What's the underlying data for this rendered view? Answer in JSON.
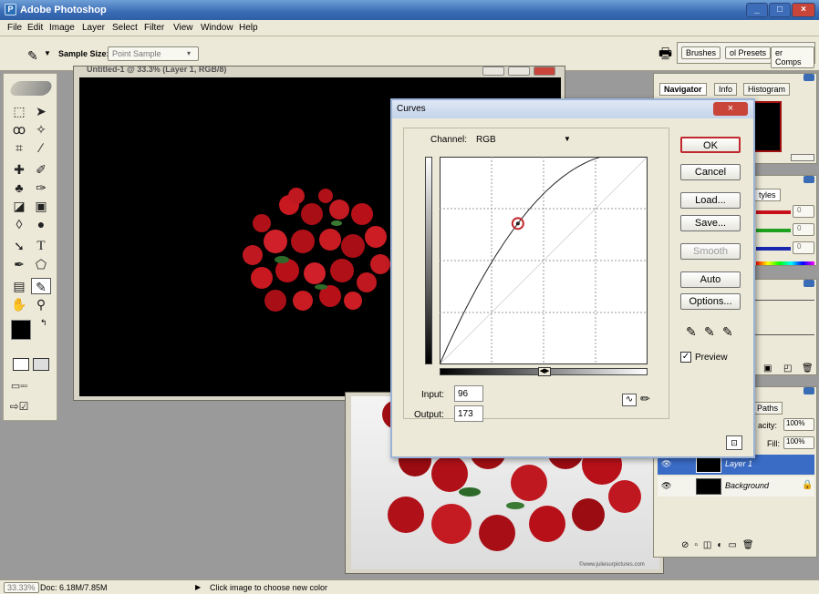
{
  "app": {
    "title": "Adobe Photoshop"
  },
  "menu": [
    "File",
    "Edit",
    "Image",
    "Layer",
    "Select",
    "Filter",
    "View",
    "Window",
    "Help"
  ],
  "options": {
    "sample_size_label": "Sample Size:",
    "sample_size_value": "Point Sample"
  },
  "palette_well": {
    "tabs": [
      "Brushes",
      "ol Presets",
      "er Comps"
    ]
  },
  "doc_title": "Untitled-1 @ 33.3% (Layer 1, RGB/8)",
  "navigator": {
    "tabs": [
      "Navigator",
      "Info",
      "Histogram"
    ]
  },
  "color_panel": {
    "tab": "tyles",
    "values": [
      "0",
      "0",
      "0"
    ]
  },
  "layers": {
    "tab": "Paths",
    "opacity_label": "acity:",
    "opacity_value": "100%",
    "fill_label": "Fill:",
    "fill_value": "100%",
    "rows": [
      {
        "name": "Layer 1"
      },
      {
        "name": "Background"
      }
    ]
  },
  "watermark": "©www.juliesurpictures.com",
  "curves": {
    "title": "Curves",
    "channel_label": "Channel:",
    "channel_value": "RGB",
    "input_label": "Input:",
    "input_value": "96",
    "output_label": "Output:",
    "output_value": "173",
    "buttons": [
      "OK",
      "Cancel",
      "Load...",
      "Save...",
      "Smooth",
      "Auto",
      "Options..."
    ],
    "preview_label": "Preview",
    "preview_checked": true,
    "curve_points": [
      [
        0,
        0
      ],
      [
        96,
        173
      ],
      [
        255,
        255
      ]
    ]
  },
  "status": {
    "zoom": "33.33%",
    "doc": "Doc: 6.18M/7.85M",
    "hint": "Click image to choose new color"
  },
  "colors": {
    "accent_red": "#c0282d",
    "title_blue": "#3a6cb5",
    "layer_selected": "#3a6cc6"
  }
}
